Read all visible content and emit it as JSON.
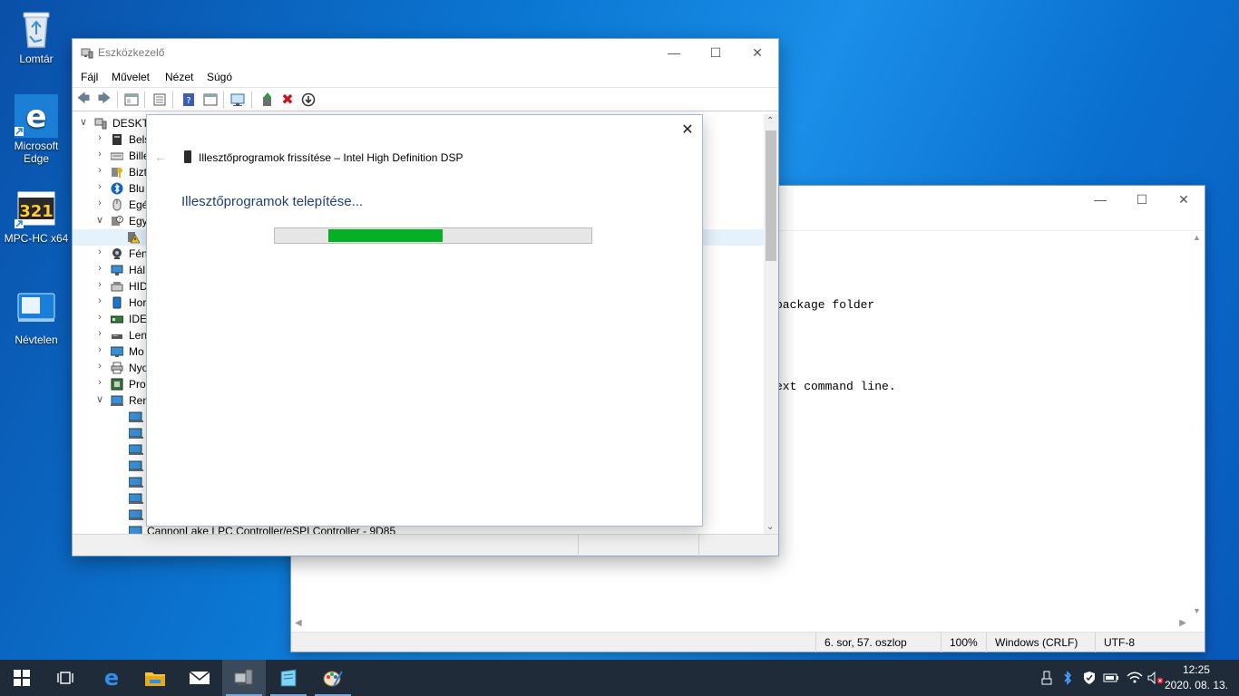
{
  "desktop": {
    "icons": [
      {
        "label": "Lomtár",
        "icon": "recycle-bin-icon"
      },
      {
        "label": "Microsoft Edge",
        "icon": "edge-icon"
      },
      {
        "label": "MPC-HC x64",
        "icon": "mpc-hc-icon"
      },
      {
        "label": "Névtelen",
        "icon": "shortcut-file-icon"
      }
    ]
  },
  "notepad": {
    "lines": [
      "package folder",
      "ext command line."
    ],
    "status": {
      "position": "6. sor, 57. oszlop",
      "zoom": "100%",
      "line_ending": "Windows (CRLF)",
      "encoding": "UTF-8"
    }
  },
  "device_manager": {
    "title": "Eszközkezelő",
    "menu": [
      "Fájl",
      "Művelet",
      "Nézet",
      "Súgó"
    ],
    "tree": {
      "root": "DESKTO",
      "items": [
        "Bels",
        "Bille",
        "Bizt",
        "Blu",
        "Egé",
        "Egy",
        "",
        "Fén",
        "Hál",
        "HID",
        "Hor",
        "IDE",
        "Len",
        "Mo",
        "Nyo",
        "Pro",
        "Ren"
      ],
      "bottom_item": "CannonLake LPC Controller/eSPI Controller - 9D85"
    }
  },
  "dialog": {
    "title": "Illesztőprogramok frissítése – Intel High Definition DSP",
    "heading": "Illesztőprogramok telepítése...",
    "progress_start": 0.17,
    "progress_end": 0.53
  },
  "taskbar": {
    "time": "12:25",
    "date": "2020. 08. 13."
  },
  "colors": {
    "accent": "#06b025",
    "heading": "#1e3f7a",
    "taskbar": "#1f2b38"
  }
}
